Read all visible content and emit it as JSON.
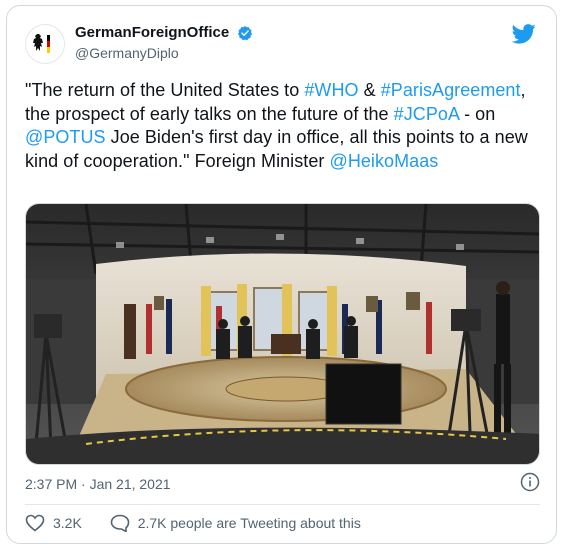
{
  "account": {
    "display_name": "GermanForeignOffice",
    "handle": "@GermanyDiplo"
  },
  "icons": {
    "avatar": "eagle-flag-icon",
    "verified": "verified-badge-icon",
    "logo": "twitter-bird-icon",
    "info": "info-icon",
    "like": "heart-icon",
    "reply": "speech-bubble-icon"
  },
  "tweet": {
    "t1": "\"The return of the United States to ",
    "who": "#WHO",
    "t2": " & ",
    "paris": "#ParisAgreement",
    "t3": ", the prospect of early talks on the future of the ",
    "jcpoa": "#JCPoA",
    "t4": " - on ",
    "potus": "@POTUS",
    "t5": " Joe Biden's first day in office, all this points to a new kind of cooperation.\" Foreign Minister ",
    "heiko": "@HeikoMaas"
  },
  "timestamp": "2:37 PM · Jan 21, 2021",
  "actions": {
    "likes": "3.2K",
    "tweeting": "2.7K people are Tweeting about this"
  },
  "colors": {
    "link": "#1d9bf0",
    "text": "#0f1419",
    "muted": "#536471",
    "border": "#cfd9de"
  }
}
